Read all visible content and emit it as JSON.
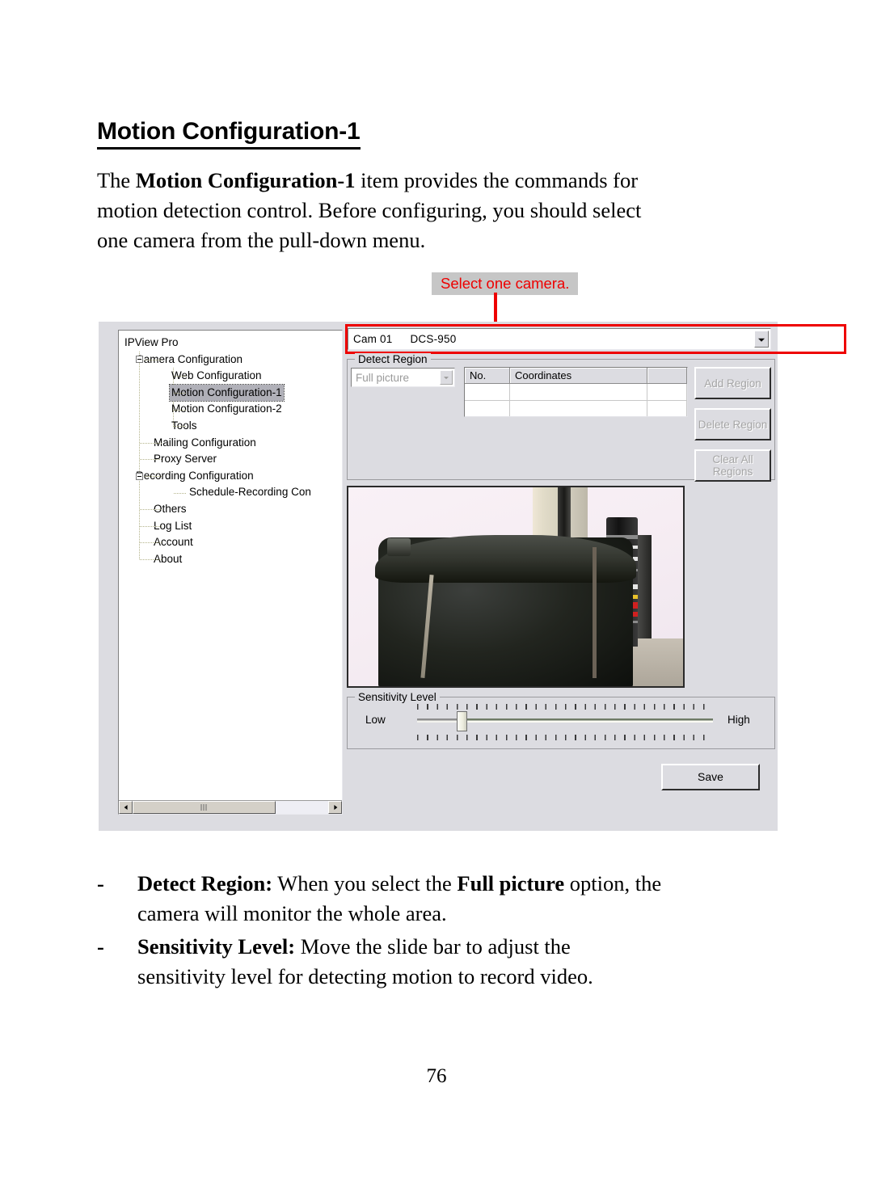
{
  "document": {
    "heading": "Motion Configuration-1",
    "intro": {
      "line1_pre": "The ",
      "line1_bold": "Motion Configuration-1",
      "line1_post": " item provides the commands for",
      "line2": "motion detection control.  Before configuring, you should select",
      "line3": "one camera from the pull-down menu."
    },
    "bullets": [
      {
        "dash": "-",
        "bold": "Detect Region:",
        "text_pre": " When you select the ",
        "bold2": "Full picture",
        "text_post": " option, the",
        "line2": "camera will monitor the whole area."
      },
      {
        "dash": "-",
        "bold": "Sensitivity Level:",
        "text_pre": " Move the slide bar to adjust the",
        "bold2": "",
        "text_post": "",
        "line2": "sensitivity level for detecting motion to record video."
      }
    ],
    "page_number": "76"
  },
  "callout": {
    "text": "Select one camera.",
    "color": "#ee0000",
    "background": "#c6c6c6"
  },
  "dialog": {
    "tree": {
      "root": "IPView Pro",
      "items": [
        {
          "label": "Camera Configuration",
          "level": 1,
          "expander": "minus"
        },
        {
          "label": "Web Configuration",
          "level": 2,
          "expander": "none"
        },
        {
          "label": "Motion Configuration-1",
          "level": 2,
          "expander": "none",
          "selected": true
        },
        {
          "label": "Motion Configuration-2",
          "level": 2,
          "expander": "none"
        },
        {
          "label": "Tools",
          "level": 2,
          "expander": "none"
        },
        {
          "label": "Mailing Configuration",
          "level": 1,
          "expander": "none"
        },
        {
          "label": "Proxy Server",
          "level": 1,
          "expander": "none"
        },
        {
          "label": "Recording Configuration",
          "level": 1,
          "expander": "minus"
        },
        {
          "label": "Schedule-Recording Con",
          "level": 2,
          "expander": "none"
        },
        {
          "label": "Others",
          "level": 1,
          "expander": "none"
        },
        {
          "label": "Log List",
          "level": 1,
          "expander": "none"
        },
        {
          "label": "Account",
          "level": 1,
          "expander": "none"
        },
        {
          "label": "About",
          "level": 1,
          "expander": "none"
        }
      ]
    },
    "camera_select": {
      "label_cam": "Cam 01",
      "label_model": "DCS-950",
      "icon": "chevron-down-icon"
    },
    "detect_region": {
      "title": "Detect Region",
      "mode_value": "Full picture",
      "mode_disabled": true,
      "columns": [
        "No.",
        "Coordinates",
        ""
      ],
      "rows": [],
      "buttons": [
        {
          "label": "Add Region",
          "disabled": true
        },
        {
          "label": "Delete Region",
          "disabled": true
        },
        {
          "label": "Clear All Regions",
          "line1": "Clear All",
          "line2": "Regions",
          "disabled": true
        }
      ]
    },
    "sensitivity": {
      "title": "Sensitivity Level",
      "low_label": "Low",
      "high_label": "High",
      "value_percent": 13
    },
    "save_label": "Save",
    "scrollbar": {
      "left_icon": "arrow-left-icon",
      "right_icon": "arrow-right-icon"
    }
  }
}
